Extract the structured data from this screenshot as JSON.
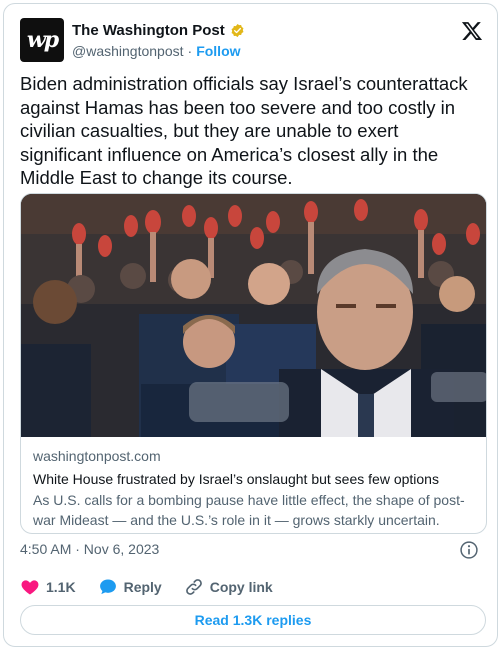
{
  "account": {
    "logo_text": "wp",
    "name": "The Washington Post",
    "handle": "@washingtonpost",
    "separator": "·",
    "follow_label": "Follow"
  },
  "icons": {
    "verified": "verified-badge-icon",
    "platform": "x-logo-icon",
    "info": "info-icon",
    "like": "heart-icon",
    "reply": "speech-bubble-icon",
    "copy_link": "link-icon"
  },
  "colors": {
    "accent": "#1d9bf0",
    "like": "#f91880",
    "verified": "#e2b719",
    "muted": "#536471",
    "text": "#0f1419"
  },
  "tweet": {
    "text": "Biden administration officials say Israel’s counterattack against Hamas has been too severe and too costly in civilian casualties, but they are unable to exert significant influence on America’s closest ally in the Middle East to change its course."
  },
  "link_card": {
    "domain": "washingtonpost.com",
    "title": "White House frustrated by Israel’s onslaught but sees few options",
    "description": "As U.S. calls for a bombing pause have little effect, the shape of post-war Mideast — and the U.S.’s role in it — grows starkly uncertain."
  },
  "meta": {
    "timestamp": "4:50 AM · Nov 6, 2023"
  },
  "actions": {
    "likes": "1.1K",
    "reply_label": "Reply",
    "copy_link_label": "Copy link"
  },
  "replies_button": {
    "label": "Read 1.3K replies"
  }
}
